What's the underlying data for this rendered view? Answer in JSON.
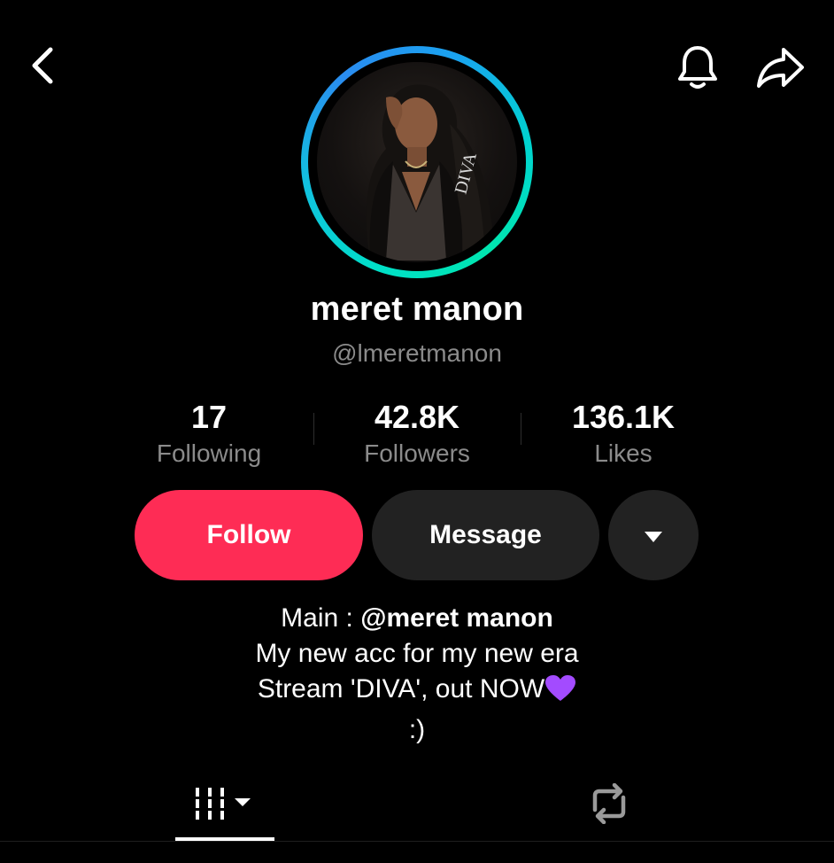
{
  "profile": {
    "display_name": "meret manon",
    "username": "@lmeretmanon",
    "avatar_text": "DIVA"
  },
  "stats": {
    "following": {
      "value": "17",
      "label": "Following"
    },
    "followers": {
      "value": "42.8K",
      "label": "Followers"
    },
    "likes": {
      "value": "136.1K",
      "label": "Likes"
    }
  },
  "actions": {
    "follow_label": "Follow",
    "message_label": "Message"
  },
  "bio": {
    "line1_prefix": "Main : ",
    "line1_mention": "@meret manon",
    "line2": "My new acc for my new era",
    "line3": "Stream 'DIVA', out NOW",
    "line4": ":)"
  },
  "icons": {
    "back": "chevron-left-icon",
    "bell": "bell-icon",
    "share": "share-arrow-icon",
    "more": "caret-down-icon",
    "videos_tab": "grid-icon",
    "reposts_tab": "repost-icon",
    "heart": "purple-heart-icon"
  },
  "colors": {
    "follow": "#fe2c55",
    "secondary_button": "#222222",
    "muted_text": "#8b8b8b",
    "ring_start": "#2a8cf0",
    "ring_end": "#00e0c8",
    "heart": "#a34bff"
  }
}
